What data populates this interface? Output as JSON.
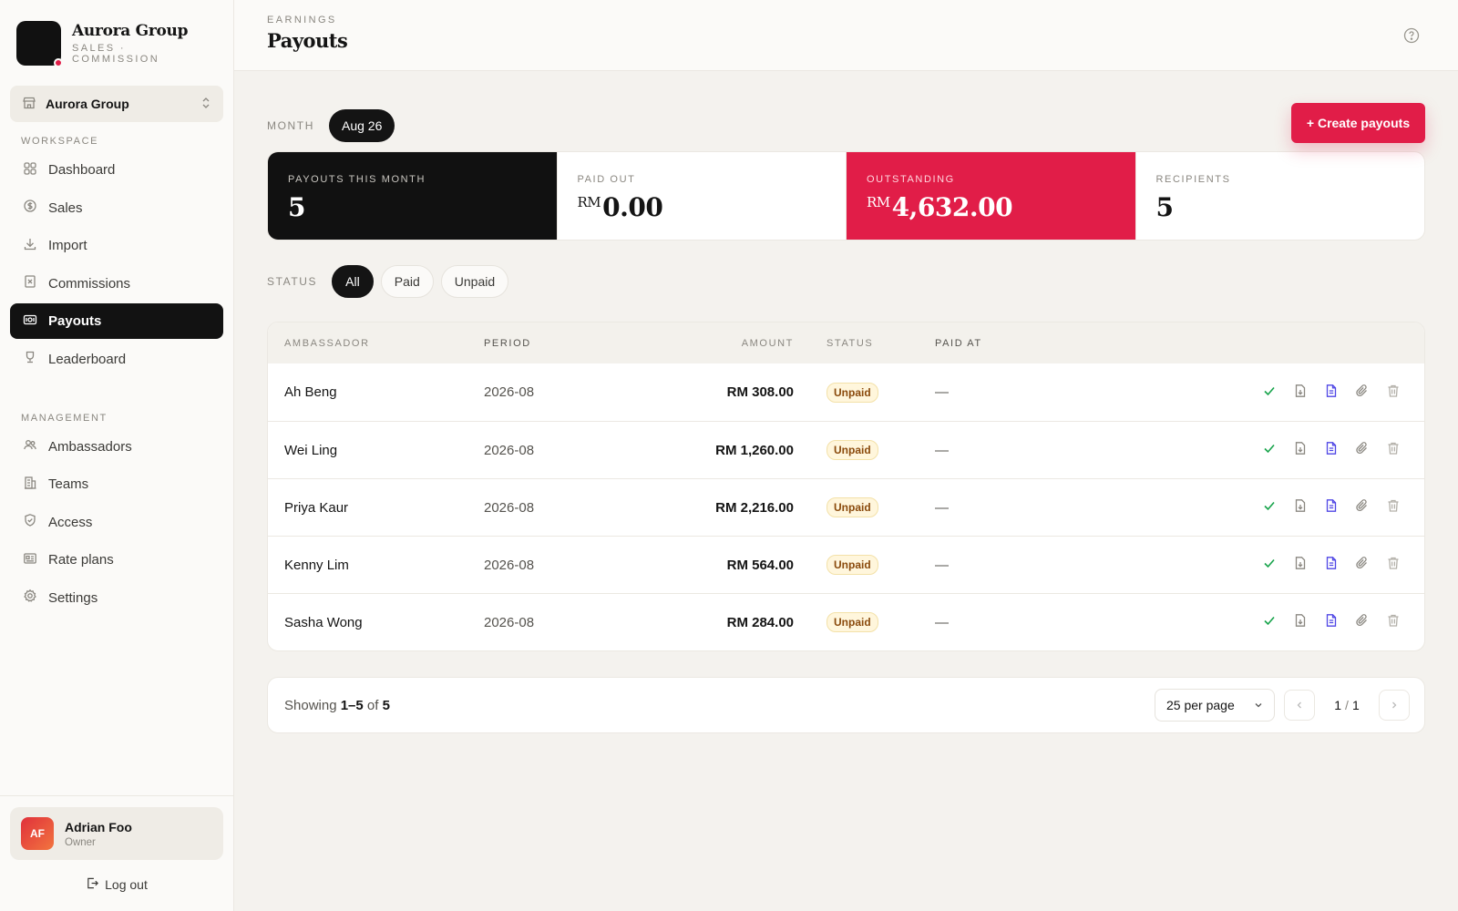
{
  "brand": {
    "name": "Aurora Group",
    "subtitle": "SALES · COMMISSION"
  },
  "org_select": {
    "label": "Aurora Group"
  },
  "sidebar": {
    "workspace_label": "WORKSPACE",
    "workspace_items": [
      {
        "label": "Dashboard",
        "icon": "dashboard-icon"
      },
      {
        "label": "Sales",
        "icon": "dollar-icon"
      },
      {
        "label": "Import",
        "icon": "download-icon"
      },
      {
        "label": "Commissions",
        "icon": "receipt-icon"
      },
      {
        "label": "Payouts",
        "icon": "banknote-icon",
        "active": true
      },
      {
        "label": "Leaderboard",
        "icon": "trophy-icon"
      }
    ],
    "management_label": "MANAGEMENT",
    "management_items": [
      {
        "label": "Ambassadors",
        "icon": "users-icon"
      },
      {
        "label": "Teams",
        "icon": "building-icon"
      },
      {
        "label": "Access",
        "icon": "shield-icon"
      },
      {
        "label": "Rate plans",
        "icon": "card-icon"
      },
      {
        "label": "Settings",
        "icon": "gear-icon"
      }
    ]
  },
  "user": {
    "initials": "AF",
    "name": "Adrian Foo",
    "role": "Owner",
    "logout_label": "Log out"
  },
  "header": {
    "eyebrow": "EARNINGS",
    "title": "Payouts"
  },
  "month": {
    "label": "MONTH",
    "value": "Aug 26"
  },
  "create_button": "+ Create payouts",
  "stats": [
    {
      "label": "PAYOUTS THIS MONTH",
      "currency": "",
      "value": "5",
      "style": "dark"
    },
    {
      "label": "PAID OUT",
      "currency": "RM",
      "value": "0.00",
      "style": "light"
    },
    {
      "label": "OUTSTANDING",
      "currency": "RM",
      "value": "4,632.00",
      "style": "red"
    },
    {
      "label": "RECIPIENTS",
      "currency": "",
      "value": "5",
      "style": "light"
    }
  ],
  "status_filter": {
    "label": "STATUS",
    "options": [
      "All",
      "Paid",
      "Unpaid"
    ],
    "selected": "All"
  },
  "table": {
    "columns": [
      "AMBASSADOR",
      "PERIOD",
      "AMOUNT",
      "STATUS",
      "PAID AT"
    ],
    "rows": [
      {
        "ambassador": "Ah Beng",
        "period": "2026-08",
        "amount": "RM 308.00",
        "status": "Unpaid",
        "paid_at": "—"
      },
      {
        "ambassador": "Wei Ling",
        "period": "2026-08",
        "amount": "RM 1,260.00",
        "status": "Unpaid",
        "paid_at": "—"
      },
      {
        "ambassador": "Priya Kaur",
        "period": "2026-08",
        "amount": "RM 2,216.00",
        "status": "Unpaid",
        "paid_at": "—"
      },
      {
        "ambassador": "Kenny Lim",
        "period": "2026-08",
        "amount": "RM 564.00",
        "status": "Unpaid",
        "paid_at": "—"
      },
      {
        "ambassador": "Sasha Wong",
        "period": "2026-08",
        "amount": "RM 284.00",
        "status": "Unpaid",
        "paid_at": "—"
      }
    ]
  },
  "pagination": {
    "showing_prefix": "Showing",
    "range": "1–5",
    "of_label": "of",
    "total": "5",
    "per_page": "25 per page",
    "current_page": "1",
    "total_pages": "1"
  },
  "colors": {
    "accent": "#e11d48",
    "dark": "#111111",
    "success": "#16a34a",
    "indigo": "#4f46e5"
  }
}
